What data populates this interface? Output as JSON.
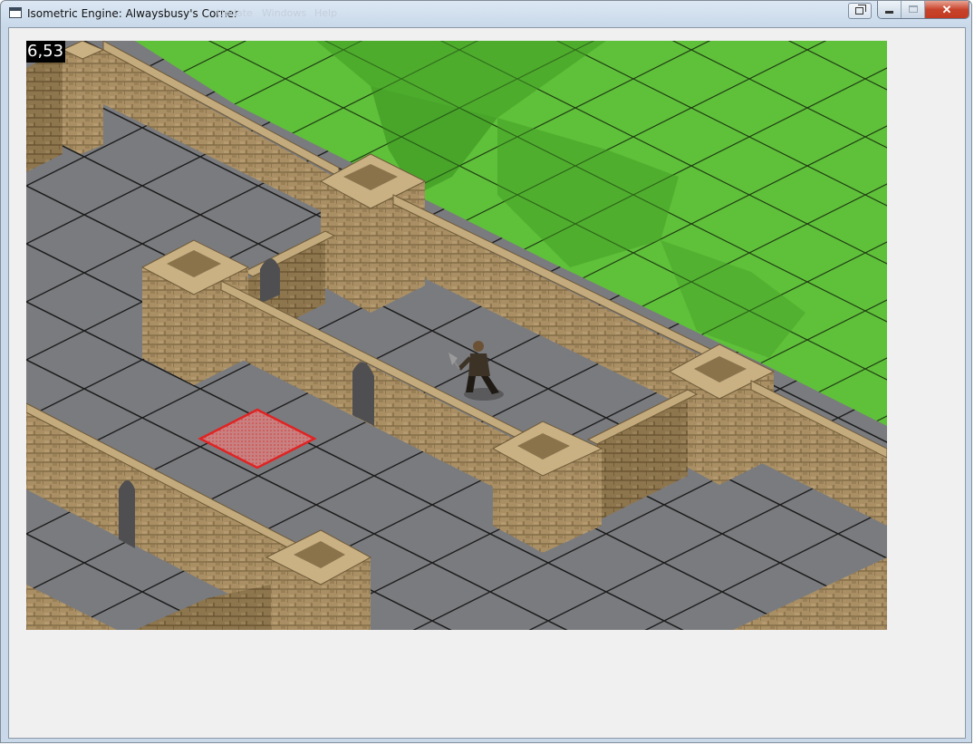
{
  "window": {
    "title": "Isometric Engine: Alwaysbusy's Corner",
    "ghost_menu": [
      "Update",
      "Windows",
      "Help"
    ],
    "close_glyph": "✕"
  },
  "hud": {
    "fps": "6,53"
  },
  "scene": {
    "grass_color": "#5fc03a",
    "grass_dark_color": "#3f9a22",
    "floor_color": "#7a7b7f",
    "wall_color": "#a98f63",
    "selection_color": "#d93b3b",
    "character": "axe-warrior"
  }
}
